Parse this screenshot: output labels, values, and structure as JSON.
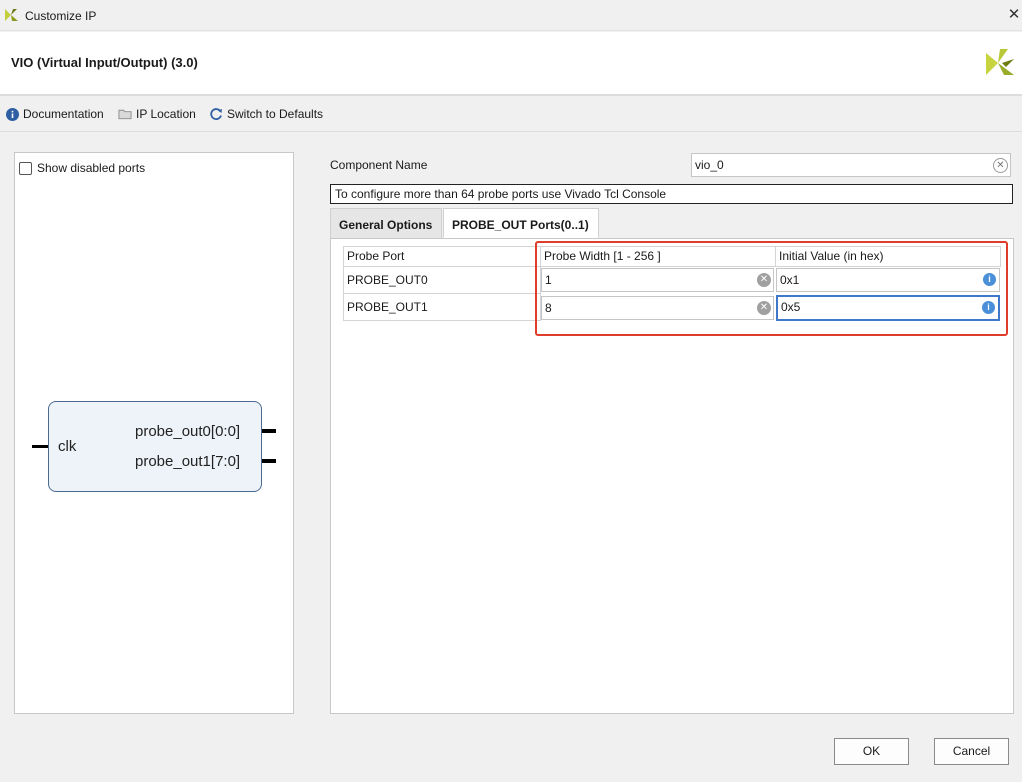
{
  "window": {
    "title": "Customize IP",
    "close_glyph": "✕"
  },
  "header": {
    "heading": "VIO (Virtual Input/Output) (3.0)"
  },
  "toolbar": {
    "documentation": "Documentation",
    "ip_location": "IP Location",
    "switch_defaults": "Switch to Defaults"
  },
  "left": {
    "show_disabled_ports": "Show disabled ports",
    "symbol": {
      "clk": "clk",
      "out0": "probe_out0[0:0]",
      "out1": "probe_out1[7:0]"
    }
  },
  "form": {
    "component_name_label": "Component Name",
    "component_name_value": "vio_0",
    "info_text": "To configure more than 64 probe ports use Vivado Tcl Console"
  },
  "tabs": [
    {
      "label": "General Options",
      "active": false
    },
    {
      "label": "PROBE_OUT Ports(0..1)",
      "active": true
    }
  ],
  "table": {
    "headers": [
      "Probe Port",
      "Probe Width [1 - 256 ]",
      "Initial Value (in hex)"
    ],
    "rows": [
      {
        "port": "PROBE_OUT0",
        "width": "1",
        "init": "0x1"
      },
      {
        "port": "PROBE_OUT1",
        "width": "8",
        "init": "0x5"
      }
    ]
  },
  "buttons": {
    "ok": "OK",
    "cancel": "Cancel"
  },
  "colors": {
    "accent": "#3f78c8",
    "highlight": "#e03c2c",
    "brand": "#b8c930"
  },
  "icons": {
    "documentation": "info-icon",
    "ip_location": "folder-icon",
    "switch_defaults": "refresh-icon",
    "clear": "clear-icon",
    "info": "info-icon"
  }
}
